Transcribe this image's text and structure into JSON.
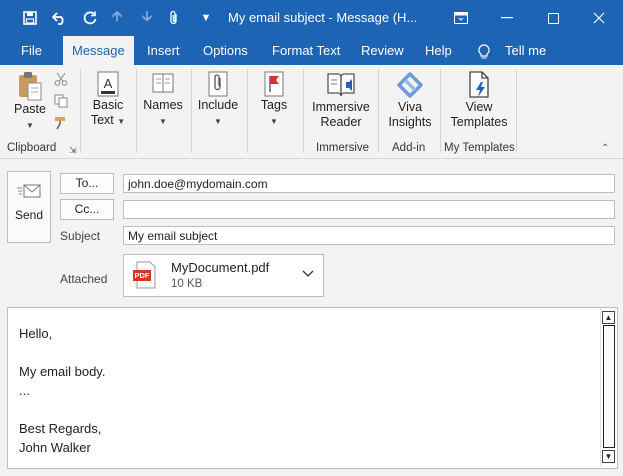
{
  "window": {
    "title": "My email subject  -  Message (H..."
  },
  "tabs": [
    "File",
    "Message",
    "Insert",
    "Options",
    "Format Text",
    "Review",
    "Help",
    "Tell me"
  ],
  "ribbon": {
    "paste": "Paste",
    "basic_text": [
      "Basic",
      "Text"
    ],
    "names": "Names",
    "include": "Include",
    "tags": "Tags",
    "immersive_reader": [
      "Immersive",
      "Reader"
    ],
    "viva_insights": [
      "Viva",
      "Insights"
    ],
    "view_templates": [
      "View",
      "Templates"
    ],
    "groups": {
      "clipboard": "Clipboard",
      "immersive": "Immersive",
      "addin": "Add-in",
      "templates": "My Templates"
    }
  },
  "compose": {
    "send": "Send",
    "to_button": "To...",
    "cc_button": "Cc...",
    "subject_label": "Subject",
    "attached_label": "Attached",
    "to_value": "john.doe@mydomain.com",
    "cc_value": "",
    "subject_value": "My email subject",
    "attachment": {
      "badge": "PDF",
      "name": "MyDocument.pdf",
      "size": "10 KB"
    }
  },
  "body": {
    "lines": [
      "Hello,",
      "My email body.",
      "...",
      "Best Regards,",
      "John Walker"
    ]
  },
  "colors": {
    "accent": "#1e64b4",
    "pdf_red": "#d9342b"
  }
}
